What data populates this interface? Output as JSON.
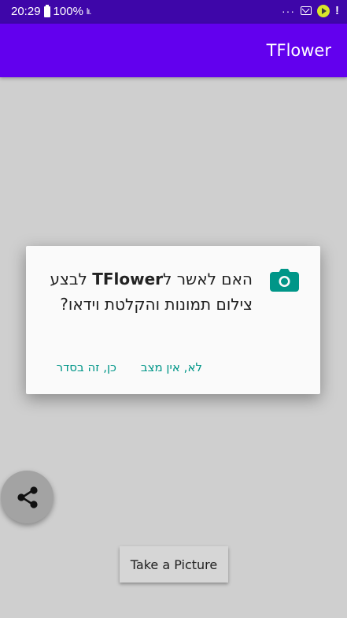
{
  "status_bar": {
    "time": "20:29",
    "battery": "100%",
    "icons": [
      "battery-icon",
      "signal-icon",
      "more-dots-icon",
      "mail-icon",
      "play-icon",
      "alert-icon"
    ],
    "more": "···",
    "alert": "!"
  },
  "app_bar": {
    "title": "TFlower",
    "color": "#6200ee"
  },
  "dialog": {
    "icon": "camera-icon",
    "message_prefix": "האם לאשר ל",
    "app_name": "TFlower",
    "message_rest": "לבצע צילום תמונות והקלטת וידאו?",
    "deny_label": "לא, אין מצב",
    "allow_label": "כן, זה בסדר",
    "accent": "#009688"
  },
  "fab": {
    "icon": "share-icon"
  },
  "take_picture": {
    "label": "Take a Picture"
  }
}
